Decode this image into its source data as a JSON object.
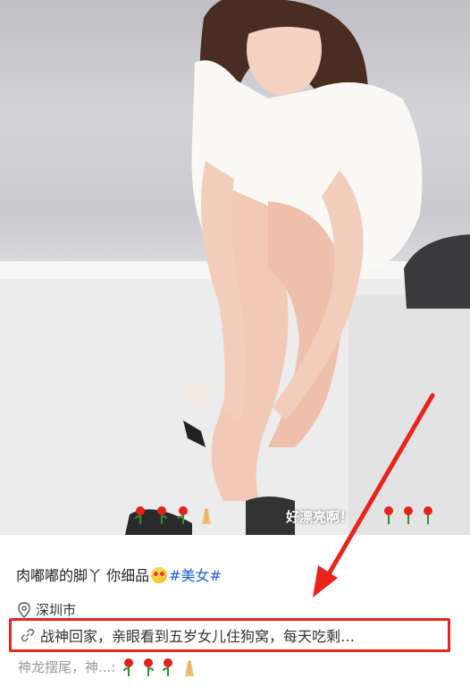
{
  "post": {
    "title_text": "肉嘟嘟的脚丫 你细品",
    "hashtag": "#美女#",
    "location": "深圳市",
    "link_text": "战神回家，亲眼看到五岁女儿住狗窝，每天吃剩…",
    "related_text": "神龙摆尾，神...:"
  },
  "danmaku": {
    "text": "好漂亮啊！"
  },
  "colors": {
    "highlight_box": "#e8241c",
    "hashtag": "#1b5ed6",
    "arrow": "#e8241c"
  },
  "icons": {
    "location": "location-pin-icon",
    "link": "link-icon",
    "emoji": "smiling-face-emoji",
    "rose": "rose-emoji",
    "pray": "folded-hands-emoji"
  }
}
